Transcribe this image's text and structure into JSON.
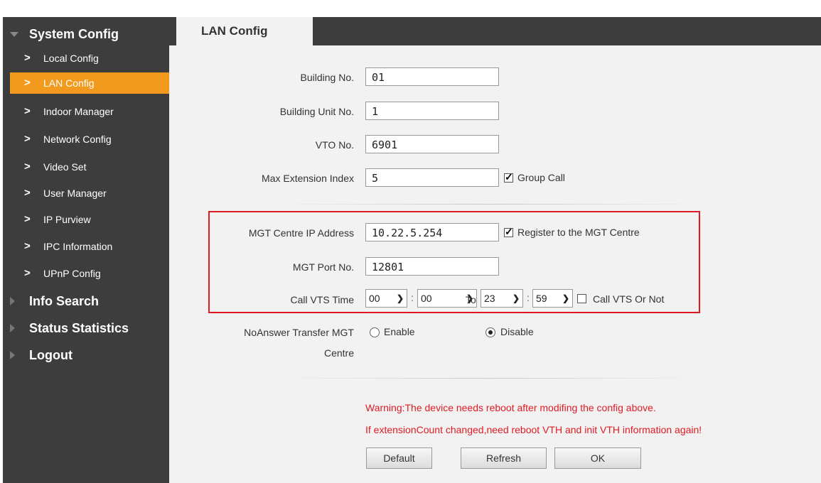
{
  "sidebar": {
    "system_config": "System Config",
    "items": [
      "Local Config",
      "LAN Config",
      "Indoor Manager",
      "Network Config",
      "Video Set",
      "User Manager",
      "IP Purview",
      "IPC Information",
      "UPnP Config"
    ],
    "info_search": "Info Search",
    "status_statistics": "Status Statistics",
    "logout": "Logout",
    "active_color": "#f19a1e"
  },
  "tab": {
    "label": "LAN Config"
  },
  "form": {
    "building_no": {
      "label": "Building No.",
      "value": "01"
    },
    "building_unit_no": {
      "label": "Building Unit No.",
      "value": "1"
    },
    "vto_no": {
      "label": "VTO No.",
      "value": "6901"
    },
    "max_extension_index": {
      "label": "Max Extension Index",
      "value": "5"
    },
    "group_call": {
      "label": "Group Call",
      "checked": true
    },
    "mgt_centre_ip": {
      "label": "MGT Centre IP Address",
      "value": "10.22.5.254"
    },
    "register_mgt": {
      "label": "Register to the MGT Centre",
      "checked": true
    },
    "mgt_port_no": {
      "label": "MGT Port No.",
      "value": "12801"
    },
    "call_vts_time": {
      "label": "Call VTS Time",
      "start_hour": "00",
      "start_min": "00",
      "to_label": "To",
      "end_hour": "23",
      "end_min": "59"
    },
    "call_vts_or_not": {
      "label": "Call VTS Or Not",
      "checked": false
    },
    "noanswer": {
      "label_line1": "NoAnswer Transfer MGT",
      "label_line2": "Centre",
      "enable_label": "Enable",
      "disable_label": "Disable",
      "selected": "Disable"
    }
  },
  "warnings": {
    "line1": "Warning:The device needs reboot after modifing the config above.",
    "line2": "If extensionCount changed,need reboot VTH and init VTH information again!",
    "color": "#e01b24"
  },
  "buttons": {
    "default": "Default",
    "refresh": "Refresh",
    "ok": "OK"
  }
}
